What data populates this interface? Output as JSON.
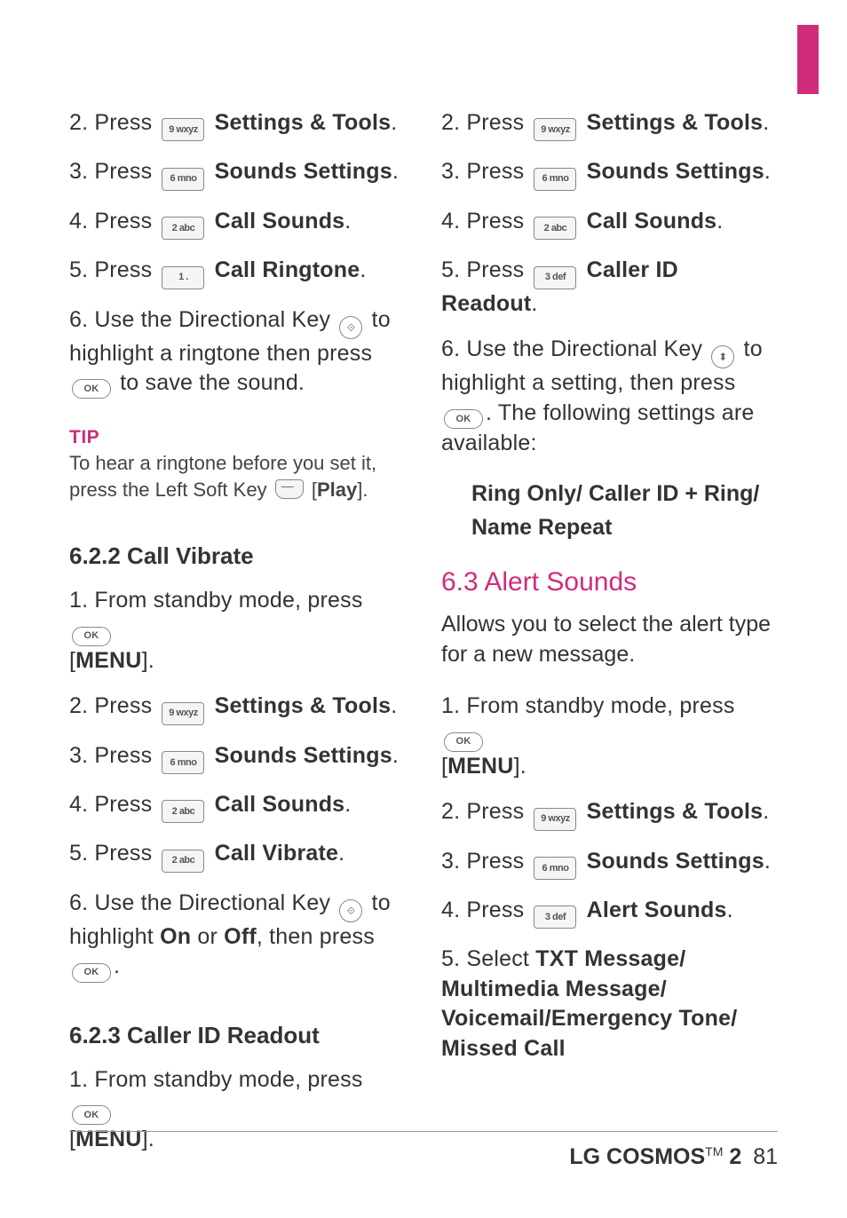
{
  "left": {
    "s2": {
      "pre": "2. Press",
      "key": "9 wxyz",
      "label": "Settings & Tools",
      "post": "."
    },
    "s3": {
      "pre": "3. Press",
      "key": "6 mno",
      "label": "Sounds Settings",
      "post": "."
    },
    "s4": {
      "pre": "4. Press",
      "key": "2 abc",
      "label": "Call Sounds",
      "post": "."
    },
    "s5": {
      "pre": "5. Press",
      "key": "1  .",
      "label": "Call Ringtone",
      "post": "."
    },
    "s6": {
      "pre": "6. Use the Directional Key",
      "mid": "to highlight a ringtone then press",
      "post": "to save the sound."
    },
    "tipLabel": "TIP",
    "tipBody": {
      "pre": "To hear a ringtone before you set it, press the Left Soft Key",
      "play": "Play",
      "post": "]."
    },
    "h622": "6.2.2 Call Vibrate",
    "v1": {
      "pre": "1. From standby mode, press",
      "menu": "MENU",
      "post": "]."
    },
    "v2": {
      "pre": "2. Press",
      "key": "9 wxyz",
      "label": "Settings & Tools",
      "post": "."
    },
    "v3": {
      "pre": "3. Press",
      "key": "6 mno",
      "label": "Sounds Settings",
      "post": "."
    },
    "v4": {
      "pre": "4. Press",
      "key": "2 abc",
      "label": "Call Sounds",
      "post": "."
    },
    "v5": {
      "pre": "5. Press",
      "key": "2 abc",
      "label": "Call Vibrate",
      "post": "."
    },
    "v6": {
      "pre": "6. Use the Directional Key",
      "mid": "to highlight",
      "on": "On",
      "or": "or",
      "off": "Off",
      "post": ", then press",
      "end": "."
    },
    "h623": "6.2.3 Caller ID Readout",
    "c1": {
      "pre": "1. From standby mode, press",
      "menu": "MENU",
      "post": "]."
    }
  },
  "right": {
    "s2": {
      "pre": "2. Press",
      "key": "9 wxyz",
      "label": "Settings & Tools",
      "post": "."
    },
    "s3": {
      "pre": "3. Press",
      "key": "6 mno",
      "label": "Sounds Settings",
      "post": "."
    },
    "s4": {
      "pre": "4. Press",
      "key": "2 abc",
      "label": "Call Sounds",
      "post": "."
    },
    "s5": {
      "pre": "5. Press",
      "key": "3 def",
      "label": "Caller ID Readout",
      "post": "."
    },
    "s6": {
      "pre": "6. Use the Directional Key",
      "mid": "to highlight a setting, then press",
      "post": ". The following settings are available:"
    },
    "opts": "Ring Only/ Caller ID + Ring/ Name Repeat",
    "h63": "6.3 Alert Sounds",
    "desc": "Allows you to select the alert type for a new message.",
    "a1": {
      "pre": "1. From standby mode, press",
      "menu": "MENU",
      "post": "]."
    },
    "a2": {
      "pre": "2. Press",
      "key": "9 wxyz",
      "label": "Settings & Tools",
      "post": "."
    },
    "a3": {
      "pre": "3. Press",
      "key": "6 mno",
      "label": "Sounds Settings",
      "post": "."
    },
    "a4": {
      "pre": "4. Press",
      "key": "3 def",
      "label": "Alert Sounds",
      "post": "."
    },
    "a5": {
      "pre": "5. Select",
      "opts": "TXT Message/ Multimedia Message/ Voicemail/Emergency Tone/ Missed Call"
    }
  },
  "footer": {
    "brand1": "LG",
    "brand2": "COSMOS",
    "tm": "TM",
    "model": "2",
    "page": "81"
  },
  "icons": {
    "ok": "OK",
    "dir": "⟐",
    "dirv": "⬍"
  }
}
